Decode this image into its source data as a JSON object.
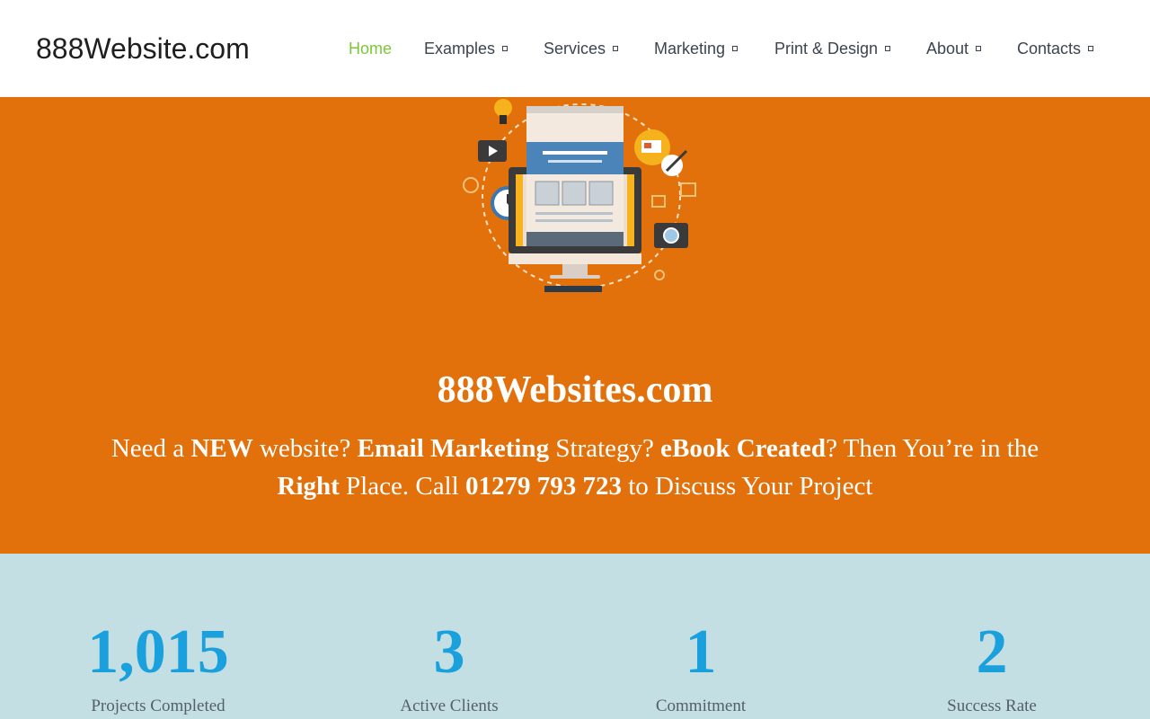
{
  "header": {
    "logo": "888Website.com",
    "nav": [
      {
        "label": "Home",
        "active": true,
        "has_dropdown": false
      },
      {
        "label": "Examples",
        "active": false,
        "has_dropdown": true
      },
      {
        "label": "Services",
        "active": false,
        "has_dropdown": true
      },
      {
        "label": "Marketing",
        "active": false,
        "has_dropdown": true
      },
      {
        "label": "Print & Design",
        "active": false,
        "has_dropdown": true
      },
      {
        "label": "About",
        "active": false,
        "has_dropdown": true
      },
      {
        "label": "Contacts",
        "active": false,
        "has_dropdown": true
      }
    ]
  },
  "hero": {
    "title": "888Websites.com",
    "line_parts": [
      {
        "text": "Need a ",
        "bold": false
      },
      {
        "text": "NEW",
        "bold": true
      },
      {
        "text": " website? ",
        "bold": false
      },
      {
        "text": "Email Marketing",
        "bold": true
      },
      {
        "text": " Strategy? ",
        "bold": false
      },
      {
        "text": "eBook Created",
        "bold": true
      },
      {
        "text": "? Then You’re in the ",
        "bold": false
      },
      {
        "text": "Right",
        "bold": true
      },
      {
        "text": " Place. Call ",
        "bold": false
      },
      {
        "text": "01279 793 723",
        "bold": true
      },
      {
        "text": " to Discuss Your Project",
        "bold": false
      }
    ],
    "illustration": "web-design-illustration"
  },
  "stats": [
    {
      "number": "1,015",
      "label": "Projects Completed"
    },
    {
      "number": "3",
      "label": "Active Clients"
    },
    {
      "number": "1",
      "label": "Commitment"
    },
    {
      "number": "2",
      "label": "Success Rate"
    }
  ],
  "colors": {
    "hero_bg": "#e2700b",
    "stats_bg": "#c4dfe4",
    "stat_number": "#1aa0dc",
    "nav_active": "#7cc63a"
  }
}
